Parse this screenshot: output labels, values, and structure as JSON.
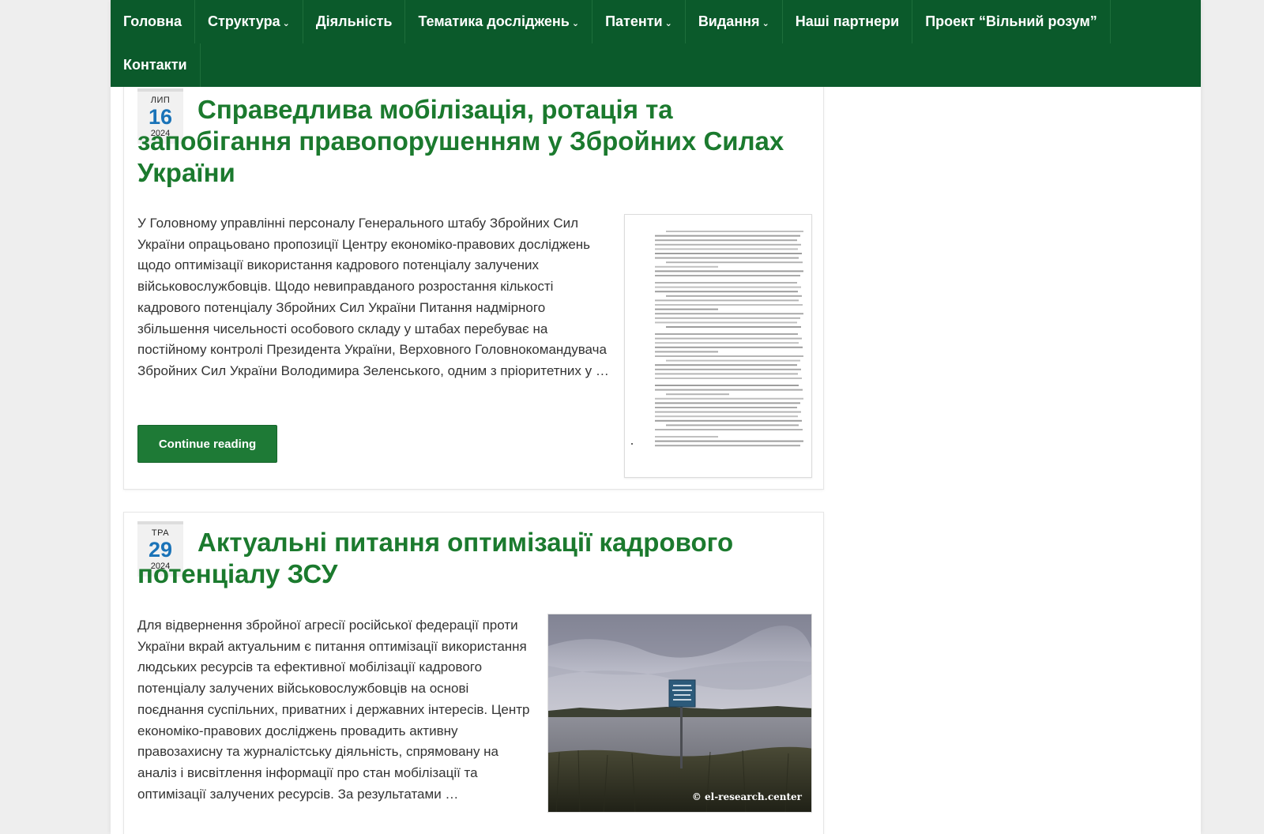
{
  "nav": {
    "items": [
      {
        "label": "Головна",
        "has_dropdown": false
      },
      {
        "label": "Структура",
        "has_dropdown": true
      },
      {
        "label": "Діяльність",
        "has_dropdown": false
      },
      {
        "label": "Тематика досліджень",
        "has_dropdown": true
      },
      {
        "label": "Патенти",
        "has_dropdown": true
      },
      {
        "label": "Видання",
        "has_dropdown": true
      },
      {
        "label": "Наші партнери",
        "has_dropdown": false
      },
      {
        "label": "Проект “Вільний розум”",
        "has_dropdown": false
      },
      {
        "label": "Контакти",
        "has_dropdown": false
      }
    ],
    "chevron": "⌄",
    "background": "#0b5a2b"
  },
  "posts": [
    {
      "date": {
        "month": "ЛИП",
        "day": "16",
        "year": "2024"
      },
      "title": "Справедлива мобілізація, ротація та запобігання правопорушенням у Збройних Силах України",
      "excerpt": "У Головному управлінні персоналу Генерального штабу Збройних Сил України опрацьовано пропозиції Центру економіко-правових досліджень щодо оптимізації використання кадрового потенціалу залучених військовослужбовців. Щодо невиправданого розростання кількості кадрового потенціалу Збройних Сил України Питання надмірного збільшення чисельності особового складу у штабах перебуває на постійному контролі Президента України, Верховного Головнокомандувача Збройних Сил України Володимира Зеленського, одним з пріоритетних у …",
      "continue_label": "Continue reading",
      "image": "document-scan-thumbnail"
    },
    {
      "date": {
        "month": "ТРА",
        "day": "29",
        "year": "2024"
      },
      "title": "Актуальні питання оптимізації кадрового потенціалу ЗСУ",
      "excerpt": "Для відвернення збройної агресії російської федерації проти України вкрай актуальним є питання оптимізації використання людських ресурсів та ефективної мобілізації кадрового потенціалу залучених військовослужбовців на основі поєднання суспільних, приватних і державних інтересів. Центр економіко-правових досліджень провадить активну правозахисну та журналістську діяльність, спрямовану на аналіз і висвітлення інформації про стан мобілізації та оптимізації залучених ресурсів. За результатами …",
      "image": "river-sign-photo",
      "image_caption": "© el-research.center"
    }
  ],
  "colors": {
    "title": "#1b7a2e",
    "date_day": "#1a73b8",
    "button": "#1e7a36"
  }
}
